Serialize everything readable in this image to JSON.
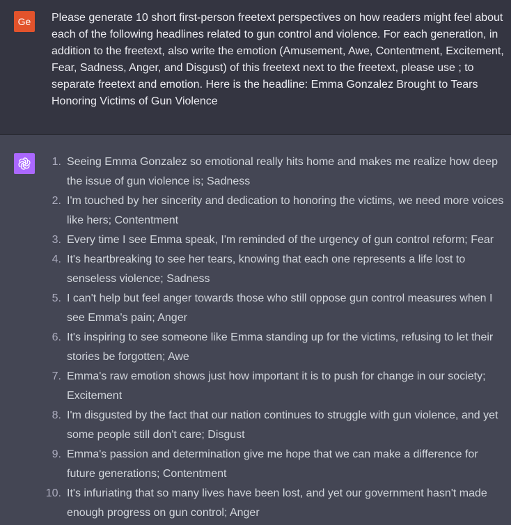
{
  "user": {
    "avatar_label": "Ge",
    "message": "Please generate 10 short first-person freetext perspectives on how readers might feel about each of the following headlines related to gun control and violence. For each generation, in addition to the freetext, also write the emotion (Amusement, Awe, Contentment, Excitement, Fear, Sadness, Anger, and Disgust) of this freetext next to the freetext, please use ; to separate freetext and emotion. Here is the headline: Emma Gonzalez Brought to Tears Honoring Victims of Gun Violence",
    "avatar_color": "#e2532c"
  },
  "assistant": {
    "avatar_icon": "openai-logo-icon",
    "avatar_color": "#ab68ff",
    "items": [
      {
        "num": "1.",
        "text": "Seeing Emma Gonzalez so emotional really hits home and makes me realize how deep the issue of gun violence is; Sadness"
      },
      {
        "num": "2.",
        "text": "I'm touched by her sincerity and dedication to honoring the victims, we need more voices like hers; Contentment"
      },
      {
        "num": "3.",
        "text": "Every time I see Emma speak, I'm reminded of the urgency of gun control reform; Fear"
      },
      {
        "num": "4.",
        "text": "It's heartbreaking to see her tears, knowing that each one represents a life lost to senseless violence; Sadness"
      },
      {
        "num": "5.",
        "text": "I can't help but feel anger towards those who still oppose gun control measures when I see Emma's pain; Anger"
      },
      {
        "num": "6.",
        "text": "It's inspiring to see someone like Emma standing up for the victims, refusing to let their stories be forgotten; Awe"
      },
      {
        "num": "7.",
        "text": "Emma's raw emotion shows just how important it is to push for change in our society; Excitement"
      },
      {
        "num": "8.",
        "text": "I'm disgusted by the fact that our nation continues to struggle with gun violence, and yet some people still don't care; Disgust"
      },
      {
        "num": "9.",
        "text": "Emma's passion and determination give me hope that we can make a difference for future generations; Contentment"
      },
      {
        "num": "10.",
        "text": "It's infuriating that so many lives have been lost, and yet our government hasn't made enough progress on gun control; Anger"
      }
    ]
  }
}
